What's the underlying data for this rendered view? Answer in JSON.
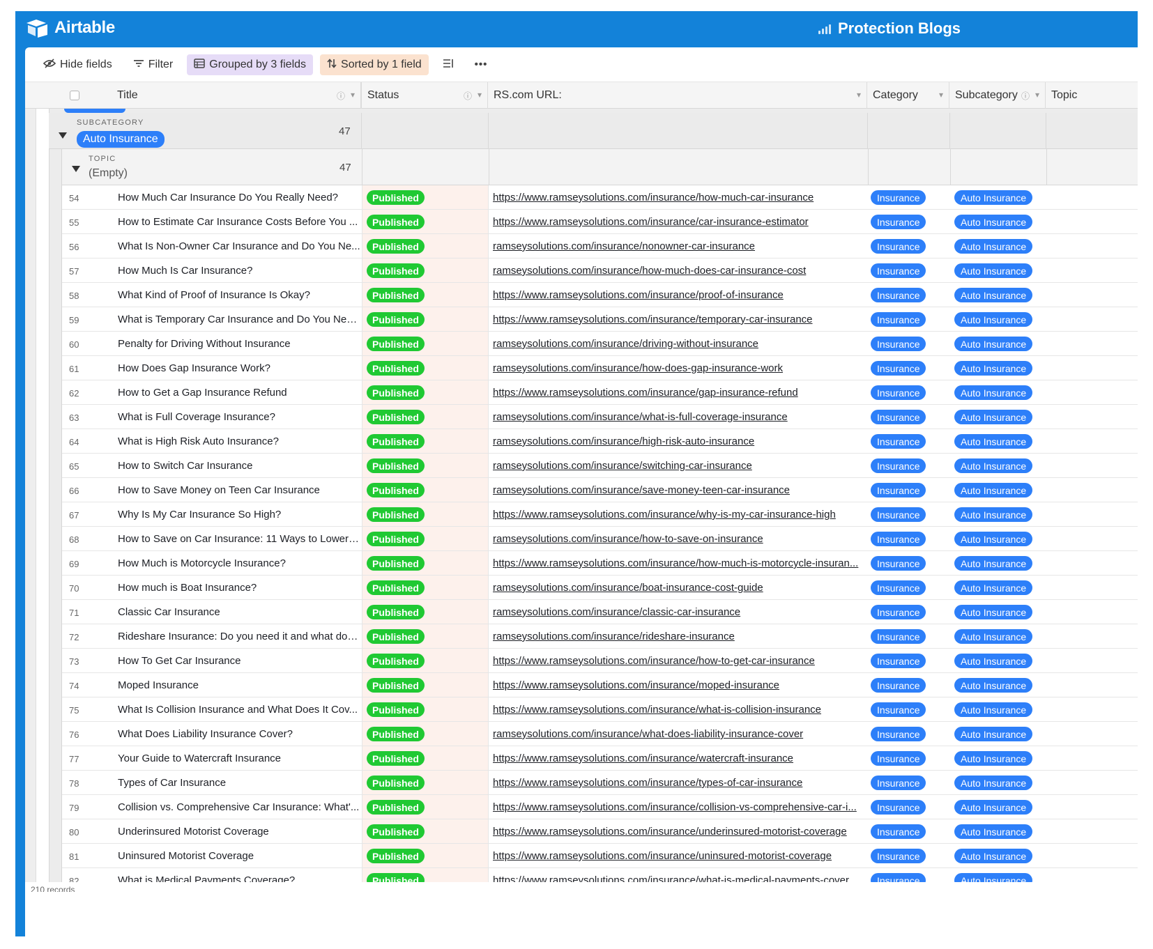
{
  "app": {
    "logo_text": "Airtable",
    "base_name": "Protection Blogs",
    "brand_color": "#1382d9"
  },
  "toolbar": {
    "hide_fields": "Hide fields",
    "filter": "Filter",
    "grouped": "Grouped by 3 fields",
    "sorted": "Sorted by 1 field"
  },
  "columns": {
    "title": "Title",
    "status": "Status",
    "url": "RS.com URL:",
    "category": "Category",
    "subcategory": "Subcategory",
    "topic": "Topic"
  },
  "groups": {
    "subcategory": {
      "label": "SUBCATEGORY",
      "value": "Auto Insurance",
      "count": "47"
    },
    "topic": {
      "label": "TOPIC",
      "value": "(Empty)",
      "count": "47"
    }
  },
  "records": [
    {
      "num": "54",
      "title": "How Much Car Insurance Do You Really Need?",
      "status": "Published",
      "url": "https://www.ramseysolutions.com/insurance/how-much-car-insurance",
      "category": "Insurance",
      "subcategory": "Auto Insurance"
    },
    {
      "num": "55",
      "title": "How to Estimate Car Insurance Costs Before You ...",
      "status": "Published",
      "url": "https://www.ramseysolutions.com/insurance/car-insurance-estimator",
      "category": "Insurance",
      "subcategory": "Auto Insurance"
    },
    {
      "num": "56",
      "title": "What Is Non-Owner Car Insurance and Do You Ne...",
      "status": "Published",
      "url": "ramseysolutions.com/insurance/nonowner-car-insurance",
      "category": "Insurance",
      "subcategory": "Auto Insurance"
    },
    {
      "num": "57",
      "title": "How Much Is Car Insurance?",
      "status": "Published",
      "url": "ramseysolutions.com/insurance/how-much-does-car-insurance-cost",
      "category": "Insurance",
      "subcategory": "Auto Insurance"
    },
    {
      "num": "58",
      "title": "What Kind of Proof of Insurance Is Okay?",
      "status": "Published",
      "url": "https://www.ramseysolutions.com/insurance/proof-of-insurance",
      "category": "Insurance",
      "subcategory": "Auto Insurance"
    },
    {
      "num": "59",
      "title": "What is Temporary Car Insurance and Do You Nee...",
      "status": "Published",
      "url": "https://www.ramseysolutions.com/insurance/temporary-car-insurance",
      "category": "Insurance",
      "subcategory": "Auto Insurance"
    },
    {
      "num": "60",
      "title": "Penalty for Driving Without Insurance",
      "status": "Published",
      "url": "ramseysolutions.com/insurance/driving-without-insurance",
      "category": "Insurance",
      "subcategory": "Auto Insurance"
    },
    {
      "num": "61",
      "title": "How Does Gap Insurance Work?",
      "status": "Published",
      "url": "ramseysolutions.com/insurance/how-does-gap-insurance-work",
      "category": "Insurance",
      "subcategory": "Auto Insurance"
    },
    {
      "num": "62",
      "title": "How to Get a Gap Insurance Refund",
      "status": "Published",
      "url": "https://www.ramseysolutions.com/insurance/gap-insurance-refund",
      "category": "Insurance",
      "subcategory": "Auto Insurance"
    },
    {
      "num": "63",
      "title": "What is Full Coverage Insurance?",
      "status": "Published",
      "url": "ramseysolutions.com/insurance/what-is-full-coverage-insurance",
      "category": "Insurance",
      "subcategory": "Auto Insurance"
    },
    {
      "num": "64",
      "title": "What is High Risk Auto Insurance?",
      "status": "Published",
      "url": "ramseysolutions.com/insurance/high-risk-auto-insurance",
      "category": "Insurance",
      "subcategory": "Auto Insurance"
    },
    {
      "num": "65",
      "title": "How to Switch Car Insurance",
      "status": "Published",
      "url": "ramseysolutions.com/insurance/switching-car-insurance",
      "category": "Insurance",
      "subcategory": "Auto Insurance"
    },
    {
      "num": "66",
      "title": "How to Save Money on Teen Car Insurance",
      "status": "Published",
      "url": "ramseysolutions.com/insurance/save-money-teen-car-insurance",
      "category": "Insurance",
      "subcategory": "Auto Insurance"
    },
    {
      "num": "67",
      "title": "Why Is My Car Insurance So High?",
      "status": "Published",
      "url": "https://www.ramseysolutions.com/insurance/why-is-my-car-insurance-high",
      "category": "Insurance",
      "subcategory": "Auto Insurance"
    },
    {
      "num": "68",
      "title": "How to Save on Car Insurance: 11 Ways to Lower Y...",
      "status": "Published",
      "url": "ramseysolutions.com/insurance/how-to-save-on-insurance",
      "category": "Insurance",
      "subcategory": "Auto Insurance"
    },
    {
      "num": "69",
      "title": "How Much is Motorcycle Insurance?",
      "status": "Published",
      "url": "https://www.ramseysolutions.com/insurance/how-much-is-motorcycle-insuran...",
      "category": "Insurance",
      "subcategory": "Auto Insurance"
    },
    {
      "num": "70",
      "title": "How much is Boat Insurance?",
      "status": "Published",
      "url": "ramseysolutions.com/insurance/boat-insurance-cost-guide",
      "category": "Insurance",
      "subcategory": "Auto Insurance"
    },
    {
      "num": "71",
      "title": "Classic Car Insurance",
      "status": "Published",
      "url": "ramseysolutions.com/insurance/classic-car-insurance",
      "category": "Insurance",
      "subcategory": "Auto Insurance"
    },
    {
      "num": "72",
      "title": "Rideshare Insurance: Do you need it and what doe...",
      "status": "Published",
      "url": "ramseysolutions.com/insurance/rideshare-insurance",
      "category": "Insurance",
      "subcategory": "Auto Insurance"
    },
    {
      "num": "73",
      "title": "How To Get Car Insurance",
      "status": "Published",
      "url": "https://www.ramseysolutions.com/insurance/how-to-get-car-insurance",
      "category": "Insurance",
      "subcategory": "Auto Insurance"
    },
    {
      "num": "74",
      "title": "Moped Insurance",
      "status": "Published",
      "url": "https://www.ramseysolutions.com/insurance/moped-insurance",
      "category": "Insurance",
      "subcategory": "Auto Insurance"
    },
    {
      "num": "75",
      "title": "What Is Collision Insurance and What Does It Cov...",
      "status": "Published",
      "url": "https://www.ramseysolutions.com/insurance/what-is-collision-insurance",
      "category": "Insurance",
      "subcategory": "Auto Insurance"
    },
    {
      "num": "76",
      "title": "What Does Liability Insurance Cover?",
      "status": "Published",
      "url": "ramseysolutions.com/insurance/what-does-liability-insurance-cover",
      "category": "Insurance",
      "subcategory": "Auto Insurance"
    },
    {
      "num": "77",
      "title": "Your Guide to Watercraft Insurance",
      "status": "Published",
      "url": "https://www.ramseysolutions.com/insurance/watercraft-insurance",
      "category": "Insurance",
      "subcategory": "Auto Insurance"
    },
    {
      "num": "78",
      "title": "Types of Car Insurance",
      "status": "Published",
      "url": "https://www.ramseysolutions.com/insurance/types-of-car-insurance",
      "category": "Insurance",
      "subcategory": "Auto Insurance"
    },
    {
      "num": "79",
      "title": "Collision vs. Comprehensive Car Insurance: What'...",
      "status": "Published",
      "url": "https://www.ramseysolutions.com/insurance/collision-vs-comprehensive-car-i...",
      "category": "Insurance",
      "subcategory": "Auto Insurance"
    },
    {
      "num": "80",
      "title": "Underinsured Motorist Coverage",
      "status": "Published",
      "url": "https://www.ramseysolutions.com/insurance/underinsured-motorist-coverage",
      "category": "Insurance",
      "subcategory": "Auto Insurance"
    },
    {
      "num": "81",
      "title": "Uninsured Motorist Coverage",
      "status": "Published",
      "url": "https://www.ramseysolutions.com/insurance/uninsured-motorist-coverage",
      "category": "Insurance",
      "subcategory": "Auto Insurance"
    },
    {
      "num": "82",
      "title": "What is Medical Payments Coverage?",
      "status": "Published",
      "url": "https://www.ramseysolutions.com/insurance/what-is-medical-payments-coverage",
      "category": "Insurance",
      "subcategory": "Auto Insurance"
    }
  ],
  "footer": {
    "record_count": "210 records"
  }
}
